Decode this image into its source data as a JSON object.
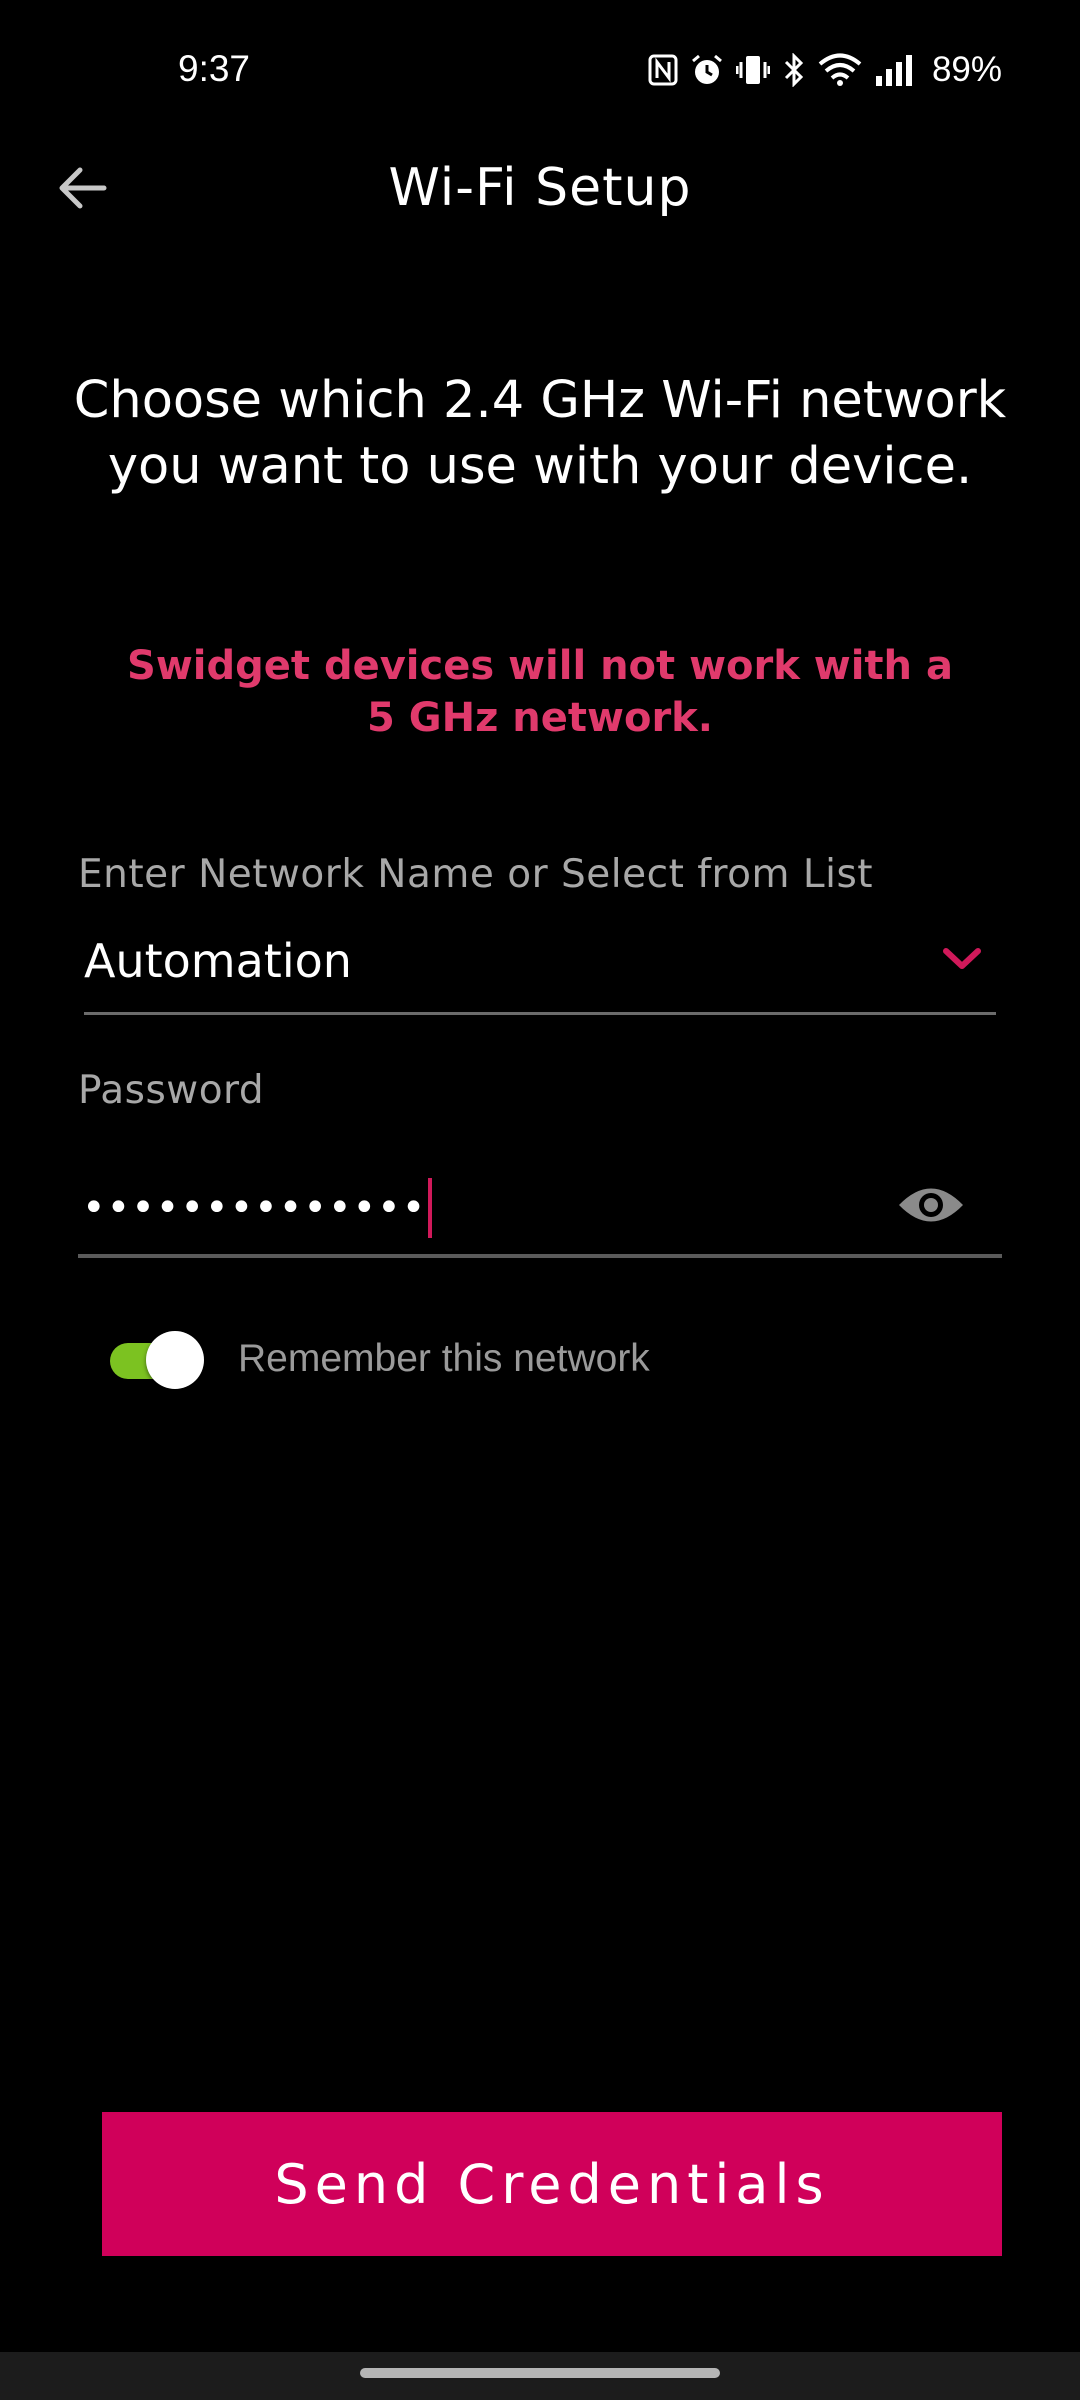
{
  "status_bar": {
    "time": "9:37",
    "battery": "89%",
    "icons": [
      "nfc-icon",
      "alarm-icon",
      "vibrate-icon",
      "bluetooth-icon",
      "wifi-icon",
      "signal-icon"
    ]
  },
  "app_bar": {
    "title": "Wi-Fi Setup",
    "back_icon": "arrow-left-icon"
  },
  "content": {
    "headline": "Choose which 2.4 GHz Wi-Fi network you want to use with your device.",
    "warning": "Swidget devices will not work with a 5 GHz network."
  },
  "network_field": {
    "label": "Enter Network Name or Select from List",
    "value": "Automation",
    "dropdown_icon": "chevron-down-icon"
  },
  "password_field": {
    "label": "Password",
    "masked_value": "••••••••••••••",
    "visibility_icon": "eye-icon"
  },
  "remember": {
    "label": "Remember this network",
    "enabled": true
  },
  "actions": {
    "send_label": "Send Credentials"
  },
  "colors": {
    "background": "#000000",
    "accent": "#d0005a",
    "warning_text": "#e03a6c",
    "toggle_on": "#7cc221",
    "muted_text": "#a8a8a8"
  }
}
